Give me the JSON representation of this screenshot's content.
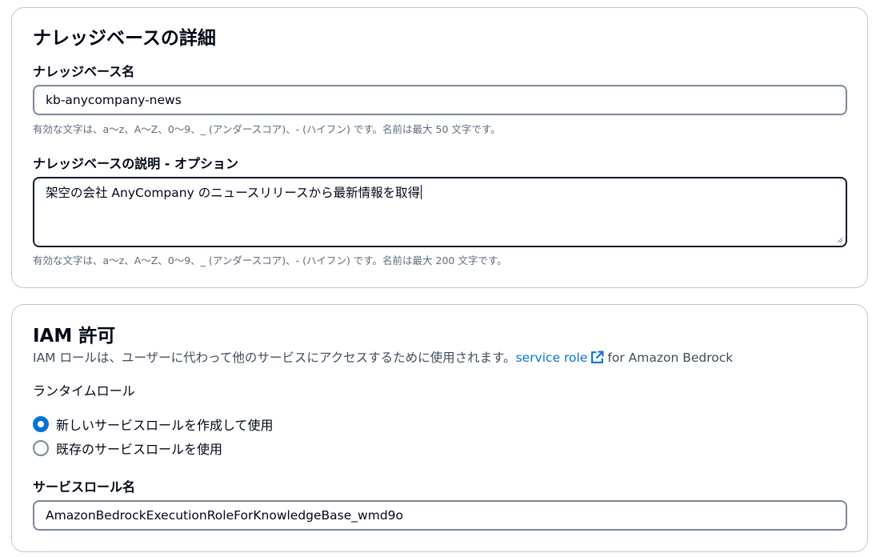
{
  "kb_details": {
    "title": "ナレッジベースの詳細",
    "name_label": "ナレッジベース名",
    "name_value": "kb-anycompany-news",
    "name_hint": "有効な文字は、a〜z、A〜Z、0〜9、_ (アンダースコア)、- (ハイフン) です。名前は最大 50 文字です。",
    "description_label": "ナレッジベースの説明 - オプション",
    "description_value": "架空の会社 AnyCompany のニュースリリースから最新情報を取得",
    "description_hint": "有効な文字は、a〜z、A〜Z、0〜9、_ (アンダースコア)、- (ハイフン) です。名前は最大 200 文字です。"
  },
  "iam": {
    "title": "IAM 許可",
    "description_prefix": "IAM ロールは、ユーザーに代わって他のサービスにアクセスするために使用されます。",
    "link_text": "service role",
    "link_icon": "external-link-icon",
    "description_suffix": "for Amazon Bedrock",
    "runtime_role_label": "ランタイムロール",
    "options": [
      {
        "label": "新しいサービスロールを作成して使用",
        "selected": true
      },
      {
        "label": "既存のサービスロールを使用",
        "selected": false
      }
    ],
    "service_role_name_label": "サービスロール名",
    "service_role_name_value": "AmazonBedrockExecutionRoleForKnowledgeBase_wmd9o"
  },
  "colors": {
    "accent": "#0972d3",
    "text": "#000716",
    "hint": "#5f6b7a",
    "border": "#7d8998",
    "focus_border": "#0f1b2a"
  }
}
